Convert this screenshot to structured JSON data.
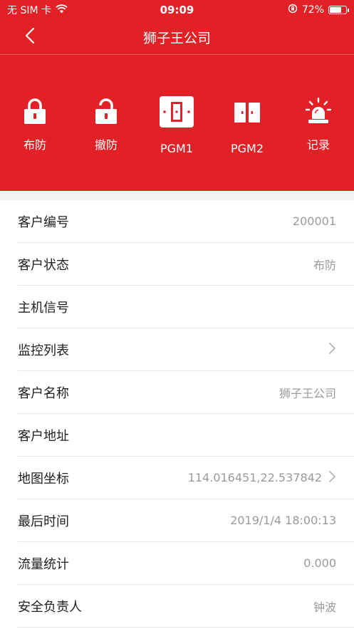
{
  "status_bar": {
    "carrier": "无 SIM 卡",
    "time": "09:09",
    "battery": "72%",
    "battery_level": 0.72
  },
  "nav": {
    "title": "狮子王公司",
    "back_icon": "chevron-left-icon"
  },
  "actions": [
    {
      "label": "布防",
      "icon": "lock-closed-icon"
    },
    {
      "label": "撤防",
      "icon": "lock-open-icon"
    },
    {
      "label": "PGM1",
      "icon": "switch-single-icon"
    },
    {
      "label": "PGM2",
      "icon": "switch-double-icon"
    },
    {
      "label": "记录",
      "icon": "alarm-light-icon"
    }
  ],
  "details": [
    {
      "key": "客户编号",
      "value": "200001",
      "chevron": false
    },
    {
      "key": "客户状态",
      "value": "布防",
      "chevron": false
    },
    {
      "key": "主机信号",
      "value": "",
      "chevron": false
    },
    {
      "key": "监控列表",
      "value": "",
      "chevron": true
    },
    {
      "key": "客户名称",
      "value": "狮子王公司",
      "chevron": false
    },
    {
      "key": "客户地址",
      "value": "",
      "chevron": false
    },
    {
      "key": "地图坐标",
      "value": "114.016451,22.537842",
      "chevron": true
    },
    {
      "key": "最后时间",
      "value": "2019/1/4 18:00:13",
      "chevron": false
    },
    {
      "key": "流量统计",
      "value": "0.000",
      "chevron": false
    },
    {
      "key": "安全负责人",
      "value": "钟波",
      "chevron": false
    }
  ],
  "colors": {
    "brand_red": "#e22126",
    "value_gray": "#9a9a9a"
  }
}
